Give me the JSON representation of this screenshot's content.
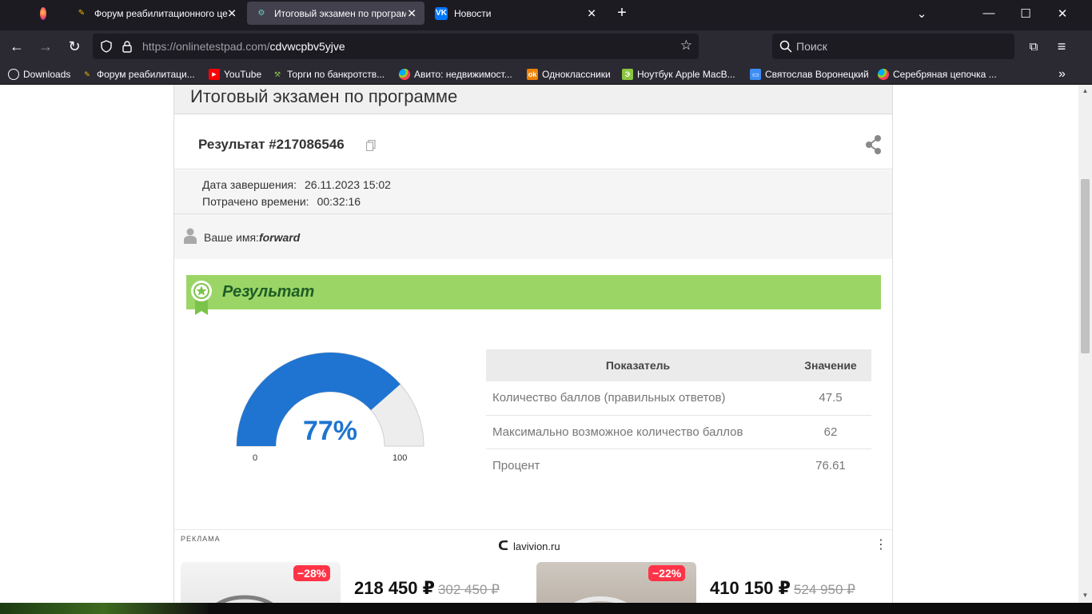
{
  "browser": {
    "tabs": [
      {
        "title": "Форум реабилитационного це",
        "active": false
      },
      {
        "title": "Итоговый экзамен по програм",
        "active": true
      },
      {
        "title": "Новости",
        "active": false
      }
    ],
    "new_tab": "+",
    "url_host": "https://onlinetestpad.com/",
    "url_path": "cdvwcpbv5yjve",
    "search_placeholder": "Поиск",
    "bookmarks": [
      {
        "label": "Downloads",
        "icon": "globe-icon"
      },
      {
        "label": "Форум реабилитаци...",
        "icon": "forum-icon"
      },
      {
        "label": "YouTube",
        "icon": "youtube-icon"
      },
      {
        "label": "Торги по банкротств...",
        "icon": "hammer-icon"
      },
      {
        "label": "Авито: недвижимост...",
        "icon": "avito-icon"
      },
      {
        "label": "Одноклассники",
        "icon": "ok-icon"
      },
      {
        "label": "Ноутбук Apple MacB...",
        "icon": "shop-icon"
      },
      {
        "label": "Святослав Воронецкий",
        "icon": "chat-icon"
      },
      {
        "label": "Серебряная цепочка ...",
        "icon": "avito-icon"
      }
    ],
    "colors": {
      "chrome_dark": "#1c1b22",
      "chrome": "#2b2a33",
      "tab_active": "#42414d"
    }
  },
  "page": {
    "exam_title": "Итоговый экзамен по программе",
    "result_title": "Результат #217086546",
    "finished_label": "Дата завершения:",
    "finished_value": "26.11.2023 15:02",
    "time_label": "Потрачено времени:",
    "time_value": "00:32:16",
    "name_label": "Ваше имя:",
    "name_value": "forward",
    "banner_title": "Результат",
    "gauge": {
      "percent_text": "77%",
      "fraction": 0.77,
      "min": "0",
      "max": "100",
      "color": "#1e74d0"
    },
    "table": {
      "headers": [
        "Показатель",
        "Значение"
      ],
      "rows": [
        {
          "label": "Количество баллов (правильных ответов)",
          "value": "47.5"
        },
        {
          "label": "Максимально возможное количество баллов",
          "value": "62"
        },
        {
          "label": "Процент",
          "value": "76.61"
        }
      ]
    },
    "ad": {
      "label": "РЕКЛАМА",
      "domain": "lavivion.ru",
      "items": [
        {
          "discount": "−28%",
          "price": "218 450 ₽",
          "old_price": "302 450 ₽"
        },
        {
          "discount": "−22%",
          "price": "410 150 ₽",
          "old_price": "524 950 ₽"
        }
      ]
    },
    "colors": {
      "banner": "#9bd566",
      "banner_text": "#1f5d26",
      "discount": "#ff3347"
    }
  }
}
